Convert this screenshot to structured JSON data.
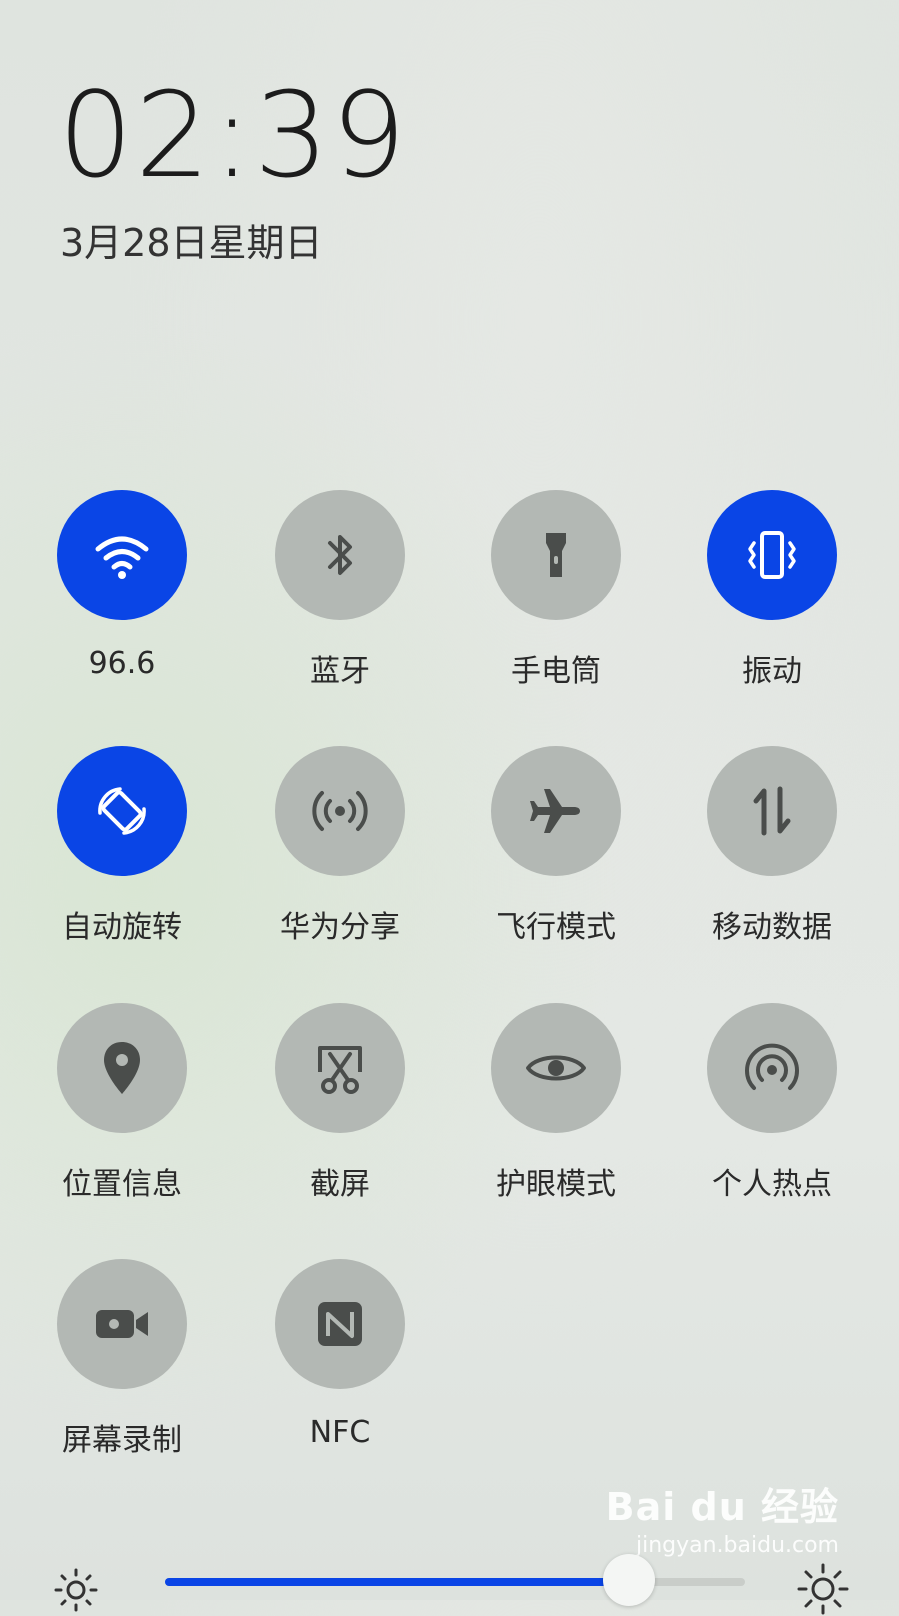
{
  "status": {
    "time": "02:39",
    "date": "3月28日星期日"
  },
  "tiles": [
    {
      "id": "wifi",
      "label": "96.6",
      "icon": "wifi-icon",
      "active": true
    },
    {
      "id": "bluetooth",
      "label": "蓝牙",
      "icon": "bluetooth-icon",
      "active": false
    },
    {
      "id": "flashlight",
      "label": "手电筒",
      "icon": "flashlight-icon",
      "active": false
    },
    {
      "id": "vibrate",
      "label": "振动",
      "icon": "vibrate-icon",
      "active": true
    },
    {
      "id": "autorotate",
      "label": "自动旋转",
      "icon": "rotate-icon",
      "active": true
    },
    {
      "id": "huawei-share",
      "label": "华为分享",
      "icon": "share-signal-icon",
      "active": false
    },
    {
      "id": "airplane",
      "label": "飞行模式",
      "icon": "airplane-icon",
      "active": false
    },
    {
      "id": "mobile-data",
      "label": "移动数据",
      "icon": "data-arrows-icon",
      "active": false
    },
    {
      "id": "location",
      "label": "位置信息",
      "icon": "location-pin-icon",
      "active": false
    },
    {
      "id": "screenshot",
      "label": "截屏",
      "icon": "scissors-screen-icon",
      "active": false
    },
    {
      "id": "eye-comfort",
      "label": "护眼模式",
      "icon": "eye-icon",
      "active": false
    },
    {
      "id": "hotspot",
      "label": "个人热点",
      "icon": "hotspot-icon",
      "active": false
    },
    {
      "id": "screen-record",
      "label": "屏幕录制",
      "icon": "video-camera-icon",
      "active": false
    },
    {
      "id": "nfc",
      "label": "NFC",
      "icon": "nfc-icon",
      "active": false
    }
  ],
  "brightness": {
    "level": 0.8
  },
  "watermark": {
    "brand": "Bai du 经验",
    "url": "jingyan.baidu.com"
  },
  "colors": {
    "accent": "#0a45e6",
    "tile_off": "#b3b8b4",
    "icon_off": "#4a4d4b",
    "icon_on": "#ffffff"
  }
}
